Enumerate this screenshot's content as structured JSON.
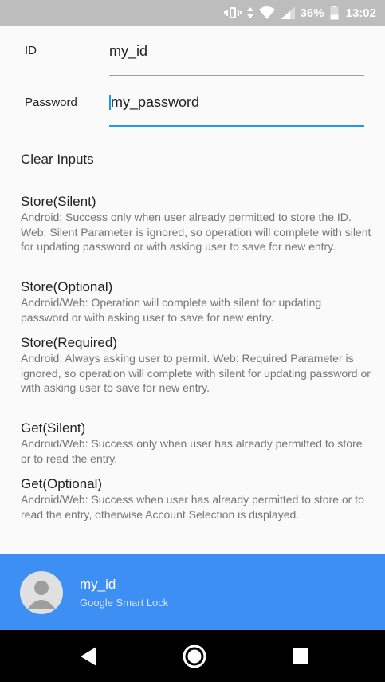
{
  "status_bar": {
    "battery": "36%",
    "time": "13:02",
    "icons": [
      "vibrate-icon",
      "data-arrows-icon",
      "wifi-icon",
      "signal-icon",
      "battery-icon"
    ]
  },
  "form": {
    "id_label": "ID",
    "id_value": "my_id",
    "password_label": "Password",
    "password_value": "my_password"
  },
  "clear_button": "Clear Inputs",
  "actions": [
    {
      "title": "Store(Silent)",
      "description": "Android: Success only when user already permitted to store the ID. Web: Silent Parameter is ignored, so operation will complete with silent for updating password or with asking user to save for new entry."
    },
    {
      "title": "Store(Optional)",
      "description": "Android/Web: Operation will complete with silent for updating password or with asking user to save for new entry."
    },
    {
      "title": "Store(Required)",
      "description": "Android: Always asking user to permit. Web: Required Parameter is ignored, so operation will complete with silent for updating password or with asking user to save for new entry."
    },
    {
      "title": "Get(Silent)",
      "description": "Android/Web: Success only when user has already permitted to store or to read the entry."
    },
    {
      "title": "Get(Optional)",
      "description": "Android/Web: Success when user has already permitted to store or to read the entry, otherwise Account Selection is displayed."
    }
  ],
  "account": {
    "name": "my_id",
    "provider": "Google Smart Lock"
  },
  "colors": {
    "accent": "#2196f3",
    "account_bar": "#3d8ff3",
    "status_bar": "#bdbdbd",
    "nav_bar": "#000000"
  },
  "nav_bar": {
    "buttons": [
      "back-icon",
      "home-icon",
      "recents-icon"
    ]
  }
}
